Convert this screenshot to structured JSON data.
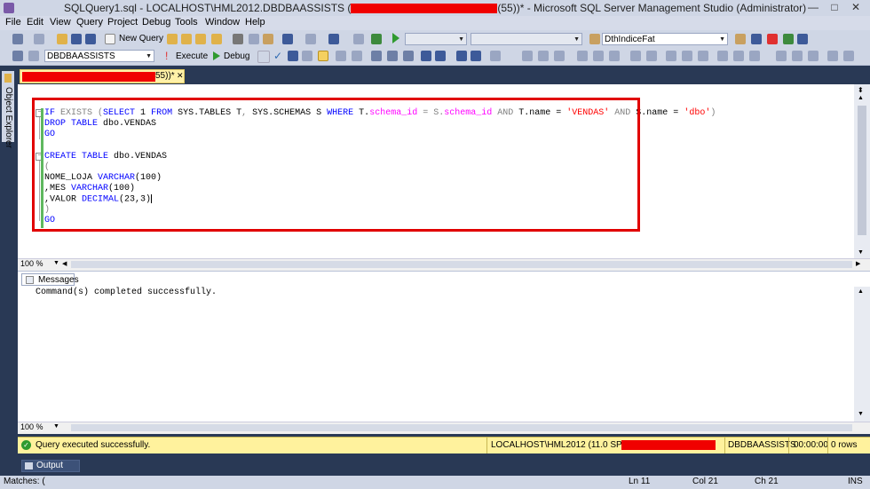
{
  "window": {
    "title_prefix": "SQLQuery1.sql - LOCALHOST\\HML2012.DBDBAASSISTS (",
    "title_suffix": "(55))* - Microsoft SQL Server Management Studio (Administrator)",
    "minimize": "—",
    "maximize": "□",
    "close": "✕"
  },
  "menu": [
    "File",
    "Edit",
    "View",
    "Query",
    "Project",
    "Debug",
    "Tools",
    "Window",
    "Help"
  ],
  "toolbar1": {
    "new_query_label": "New Query",
    "combo_value": "DthIndiceFat"
  },
  "toolbar2": {
    "database_value": "DBDBAASSISTS",
    "execute_label": "Execute",
    "debug_label": "Debug"
  },
  "sidebar": {
    "object_explorer_label": "Object Explorer"
  },
  "doc_tab": {
    "suffix": "55))*",
    "close": "✕"
  },
  "editor": {
    "zoom": "100 %",
    "code": {
      "l1_if": "IF",
      "l1_exists": " EXISTS (",
      "l1_select": "SELECT",
      "l1_1": " 1 ",
      "l1_from": "FROM",
      "l1_sys_tables": " SYS.TABLES",
      " l1_rest": "",
      "l1_t": " T",
      "l1_comma": ", ",
      "l1_sys_schemas": "SYS.SCHEMAS",
      "l1_s": " S ",
      "l1_where": "WHERE",
      "l1_tdot": " T.",
      "l1_schema_id": "schema_id",
      "l1_eq": " = S.",
      "l1_schema_id2": "schema_id",
      "l1_and": " AND ",
      "l1_tname": "T.name = ",
      "l1_vendas": "'VENDAS'",
      "l1_and2": " AND ",
      "l1_sname": "S.name = ",
      "l1_dbo": "'dbo'",
      "l1_close": ")",
      "l2_drop": "DROP",
      "l2_table": " TABLE",
      "l2_name": " dbo.VENDAS",
      "l3_go": "GO",
      "l5_create": "CREATE",
      "l5_table": " TABLE",
      "l5_name": " dbo.VENDAS",
      "l6_paren": "(",
      "l7_col": "NOME_LOJA ",
      "l7_type": "VARCHAR",
      "l7_size": "(100)",
      "l8_col": ",MES ",
      "l8_type": "VARCHAR",
      "l8_size": "(100)",
      "l9_col": ",VALOR ",
      "l9_type": "DECIMAL",
      "l9_size": "(23,3)",
      "l10_paren": ")",
      "l11_go": "GO"
    }
  },
  "results": {
    "tab_label": "Messages",
    "message": "Command(s) completed successfully.",
    "zoom": "100 %"
  },
  "status": {
    "message": "Query executed successfully.",
    "server": "LOCALHOST\\HML2012 (11.0 SP4)",
    "database": "DBDBAASSISTS",
    "elapsed": "00:00:00",
    "rows": "0 rows"
  },
  "output": {
    "label": "Output"
  },
  "bottom": {
    "matches": "Matches: (",
    "ln": "Ln 11",
    "col": "Col 21",
    "ch": "Ch 21",
    "ins": "INS"
  },
  "colors": {
    "keyword": "#0000ff",
    "string": "#ff0000",
    "function": "#ff00ff",
    "comment_gray": "#808080",
    "highlight_border": "#e10000",
    "status_bg": "#fff29d"
  }
}
